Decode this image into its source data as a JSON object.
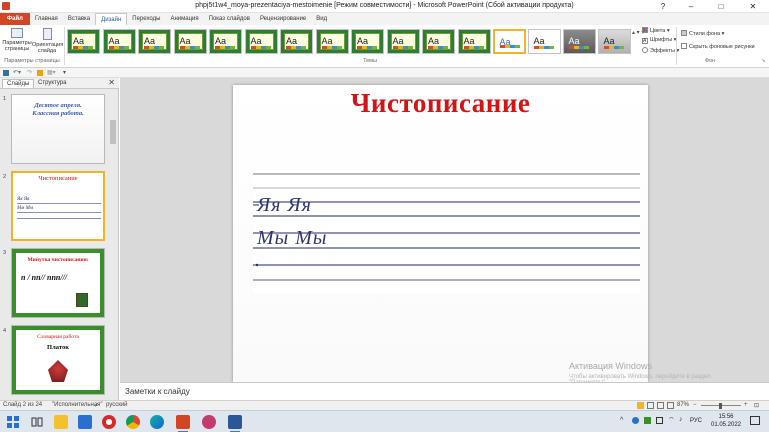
{
  "window": {
    "title": "phpj5t1w4_moya-prezentaciya-mestoimenie [Режим совместимости] - Microsoft PowerPoint (Сбой активации продукта)",
    "minimize": "–",
    "maximize": "□",
    "close": "✕"
  },
  "ribbon": {
    "tabs": [
      {
        "label": "Файл"
      },
      {
        "label": "Главная"
      },
      {
        "label": "Вставка"
      },
      {
        "label": "Дизайн"
      },
      {
        "label": "Переходы"
      },
      {
        "label": "Анимация"
      },
      {
        "label": "Показ слайдов"
      },
      {
        "label": "Рецензирование"
      },
      {
        "label": "Вид"
      }
    ],
    "page_setup": {
      "params_label": "Параметры страницы",
      "orientation_label": "Ориентация слайда",
      "group_label": "Параметры страницы"
    },
    "themes": {
      "group_label": "Темы",
      "thumb_text": "Aa"
    },
    "theme_options": {
      "colors": "Цвета",
      "fonts": "Шрифты",
      "effects": "Эффекты"
    },
    "background": {
      "styles": "Стили фона",
      "hide_graphics": "Скрыть фоновые рисунки",
      "group_label": "Фон"
    }
  },
  "left_panel": {
    "tab_slides": "Слайды",
    "tab_outline": "Структура",
    "close": "✕",
    "thumbnails": [
      {
        "num": "1",
        "line1": "Десятое апреля.",
        "line2": "Классная работа."
      },
      {
        "num": "2",
        "title": "Чистописание",
        "line1": "Яя  Яя",
        "line2": "Мм  Мм"
      },
      {
        "num": "3",
        "title": "Минутка  чистописания:",
        "body": "n / nn// nnn///"
      },
      {
        "num": "4",
        "title": "Словарная работа",
        "body": "Платок"
      }
    ]
  },
  "slide": {
    "title": "Чистописание",
    "line1": "Яя  Яя",
    "line2": "Мы  Мы"
  },
  "notes": {
    "placeholder": "Заметки к слайду"
  },
  "watermark": {
    "title": "Активация Windows",
    "subtitle": "Чтобы активировать Windows, перейдите в раздел",
    "subtitle2": "\"Параметры\"."
  },
  "status": {
    "slide_of": "Слайд 2 из 24",
    "theme_name": "\"Исполнительная\"",
    "language": "русский",
    "zoom": "87%"
  },
  "taskbar": {
    "lang": "РУС",
    "time": "15:56",
    "date": "01.05.2022"
  },
  "colors": {
    "file_tab": "#d24625",
    "title_red": "#d21414",
    "handwriting": "#2e3570",
    "guideline": "#1f2a6b",
    "theme_green": "#2e7d32",
    "selection": "#f0b429"
  }
}
